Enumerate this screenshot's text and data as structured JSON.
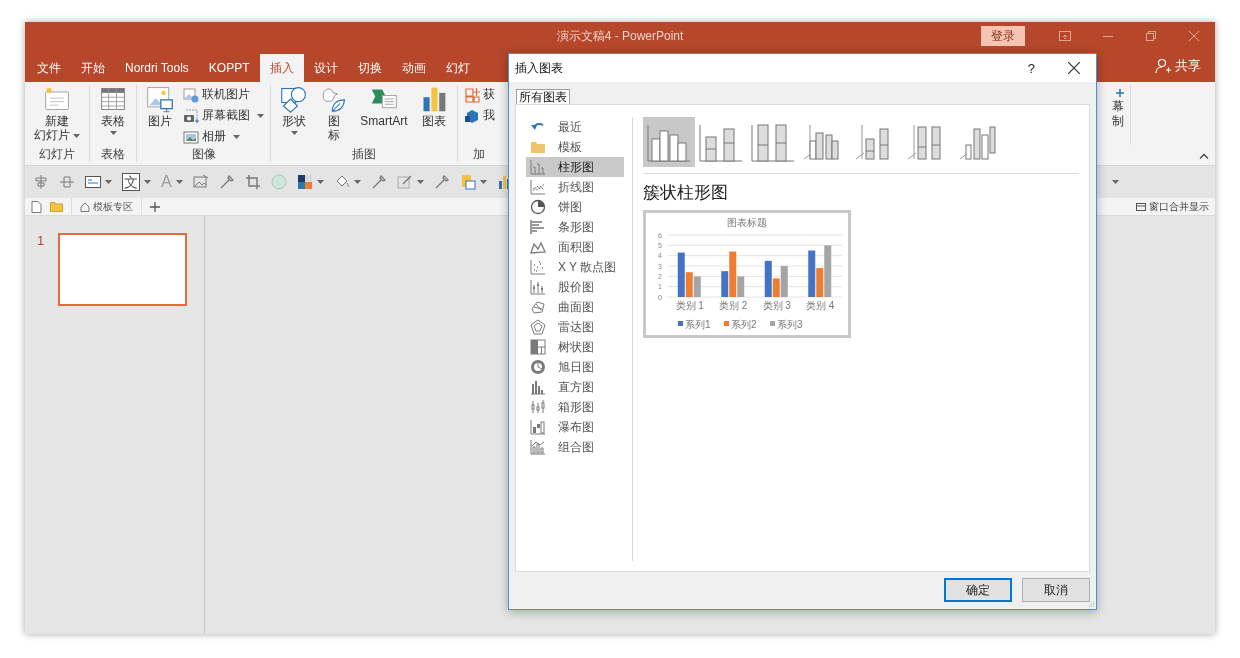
{
  "window": {
    "title": "演示文稿4  -  PowerPoint",
    "login": "登录"
  },
  "tabs": [
    {
      "label": "文件",
      "selected": false
    },
    {
      "label": "开始",
      "selected": false
    },
    {
      "label": "Nordri Tools",
      "selected": false
    },
    {
      "label": "KOPPT",
      "selected": false
    },
    {
      "label": "插入",
      "selected": true
    },
    {
      "label": "设计",
      "selected": false
    },
    {
      "label": "切换",
      "selected": false
    },
    {
      "label": "动画",
      "selected": false
    },
    {
      "label": "幻灯",
      "selected": false
    }
  ],
  "share": "共享",
  "ribbon": {
    "groups": [
      {
        "label": "幻灯片",
        "buttons": [
          {
            "kind": "large",
            "lines": [
              "新建",
              "幻灯片"
            ],
            "dropdown": true
          }
        ]
      },
      {
        "label": "表格",
        "buttons": [
          {
            "kind": "large",
            "lines": [
              "表格"
            ],
            "dropdown": true
          }
        ]
      },
      {
        "label": "图像",
        "buttons": [
          {
            "kind": "large",
            "lines": [
              "图片"
            ],
            "dropdown": false
          },
          {
            "kind": "small",
            "lines": [
              "联机图片"
            ],
            "dropdown": false
          },
          {
            "kind": "small",
            "lines": [
              "屏幕截图"
            ],
            "dropdown": true
          },
          {
            "kind": "small",
            "lines": [
              "相册"
            ],
            "dropdown": true
          }
        ]
      },
      {
        "label": "插图",
        "buttons": [
          {
            "kind": "large",
            "lines": [
              "形状"
            ],
            "dropdown": true
          },
          {
            "kind": "large",
            "lines": [
              "图",
              "标"
            ],
            "dropdown": false
          },
          {
            "kind": "large",
            "lines": [
              "SmartArt"
            ],
            "dropdown": false
          },
          {
            "kind": "large",
            "lines": [
              "图表"
            ],
            "dropdown": false
          }
        ]
      },
      {
        "label": "加",
        "buttons": [
          {
            "kind": "small",
            "lines": [
              "获"
            ],
            "dropdown": false
          },
          {
            "kind": "small",
            "lines": [
              "我"
            ],
            "dropdown": false
          }
        ]
      }
    ],
    "right_button": {
      "lines": [
        "幕",
        "制"
      ]
    }
  },
  "toolbar": [
    {
      "kind": "icon",
      "dropdown": false
    },
    {
      "kind": "icon",
      "dropdown": false
    },
    {
      "kind": "icon",
      "dropdown": true
    },
    {
      "kind": "boxed",
      "text": "文",
      "dropdown": true
    },
    {
      "kind": "glyph",
      "text": "A",
      "dropdown": true
    },
    {
      "kind": "icon",
      "dropdown": false
    },
    {
      "kind": "icon",
      "dropdown": false
    },
    {
      "kind": "icon",
      "dropdown": false
    },
    {
      "kind": "icon",
      "dropdown": false
    },
    {
      "kind": "icon",
      "dropdown": true
    },
    {
      "kind": "icon",
      "dropdown": true
    },
    {
      "kind": "icon",
      "dropdown": false
    },
    {
      "kind": "icon",
      "dropdown": true
    },
    {
      "kind": "icon",
      "dropdown": false
    },
    {
      "kind": "icon",
      "dropdown": true
    },
    {
      "kind": "icon",
      "dropdown": false
    }
  ],
  "doc_tabs": {
    "tabs": [
      {
        "label": "模板专区"
      }
    ],
    "merge": "窗口合并显示"
  },
  "slides": [
    {
      "number": "1",
      "selected": true
    }
  ],
  "dialog": {
    "title": "插入图表",
    "help": "?",
    "tab": "所有图表",
    "types": [
      {
        "label": "最近",
        "selected": false
      },
      {
        "label": "模板",
        "selected": false
      },
      {
        "label": "柱形图",
        "selected": true
      },
      {
        "label": "折线图",
        "selected": false
      },
      {
        "label": "饼图",
        "selected": false
      },
      {
        "label": "条形图",
        "selected": false
      },
      {
        "label": "面积图",
        "selected": false
      },
      {
        "label": "X Y 散点图",
        "selected": false
      },
      {
        "label": "股价图",
        "selected": false
      },
      {
        "label": "曲面图",
        "selected": false
      },
      {
        "label": "雷达图",
        "selected": false
      },
      {
        "label": "树状图",
        "selected": false
      },
      {
        "label": "旭日图",
        "selected": false
      },
      {
        "label": "直方图",
        "selected": false
      },
      {
        "label": "箱形图",
        "selected": false
      },
      {
        "label": "瀑布图",
        "selected": false
      },
      {
        "label": "组合图",
        "selected": false
      }
    ],
    "subtypes": [
      {
        "selected": true
      },
      {
        "selected": false
      },
      {
        "selected": false
      },
      {
        "selected": false
      },
      {
        "selected": false
      },
      {
        "selected": false
      },
      {
        "selected": false
      }
    ],
    "subtype_title": "簇状柱形图",
    "preview": {
      "chart_data": {
        "type": "bar",
        "title": "图表标题",
        "categories": [
          "类别 1",
          "类别 2",
          "类别 3",
          "类别 4"
        ],
        "series": [
          {
            "name": "系列1",
            "color": "#4472c4",
            "values": [
              4.3,
              2.5,
              3.5,
              4.5
            ]
          },
          {
            "name": "系列2",
            "color": "#ed7d31",
            "values": [
              2.4,
              4.4,
              1.8,
              2.8
            ]
          },
          {
            "name": "系列3",
            "color": "#a5a5a5",
            "values": [
              2,
              2,
              3,
              5
            ]
          }
        ],
        "ylim": [
          0,
          6
        ],
        "yticks": [
          0,
          1,
          2,
          3,
          4,
          5,
          6
        ],
        "grid": true,
        "legend": true
      }
    },
    "buttons": [
      {
        "label": "确定",
        "default": true
      },
      {
        "label": "取消",
        "default": false
      }
    ]
  }
}
